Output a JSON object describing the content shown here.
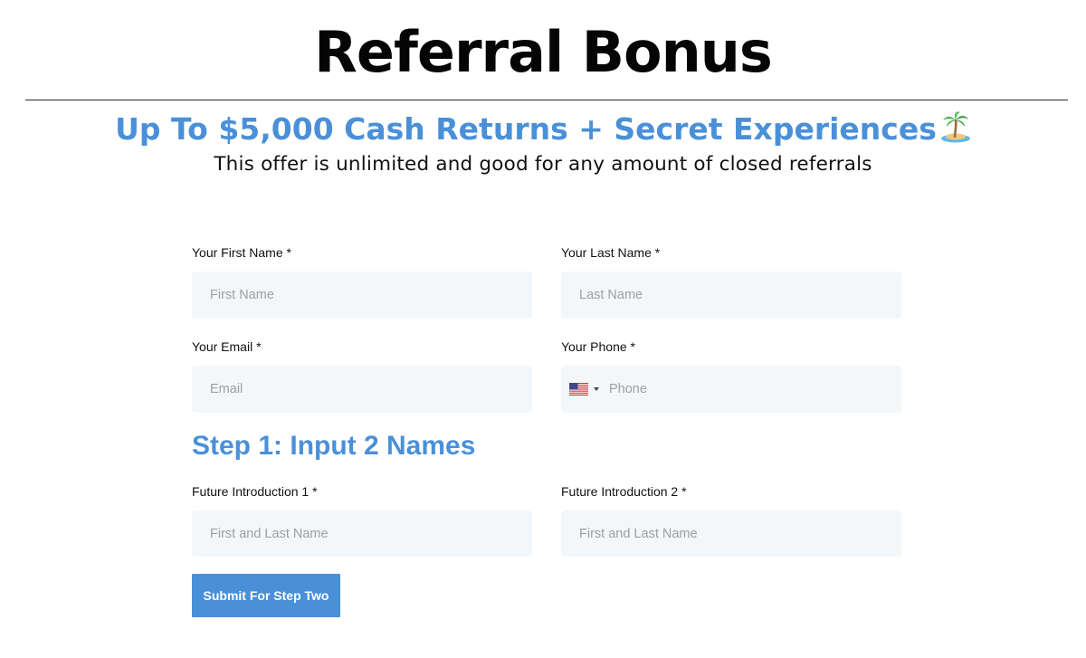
{
  "header": {
    "title": "Referral Bonus",
    "headline": "Up To $5,000 Cash Returns + Secret Experiences",
    "headline_icon": "desert-island-emoji",
    "subhead": "This offer is unlimited and good for any amount of closed referrals"
  },
  "form": {
    "first_name": {
      "label": "Your First Name *",
      "placeholder": "First Name",
      "value": ""
    },
    "last_name": {
      "label": "Your Last Name *",
      "placeholder": "Last Name",
      "value": ""
    },
    "email": {
      "label": "Your Email *",
      "placeholder": "Email",
      "value": ""
    },
    "phone": {
      "label": "Your Phone *",
      "placeholder": "Phone",
      "value": "",
      "country_icon": "us-flag-icon"
    },
    "step_title": "Step 1: Input 2 Names",
    "intro1": {
      "label": "Future Introduction 1 *",
      "placeholder": "First and Last Name",
      "value": ""
    },
    "intro2": {
      "label": "Future Introduction 2 *",
      "placeholder": "First and Last Name",
      "value": ""
    },
    "submit_label": "Submit For Step Two"
  },
  "colors": {
    "accent": "#4a90d9",
    "field_bg": "#f4f7f9",
    "title": "#050505"
  }
}
